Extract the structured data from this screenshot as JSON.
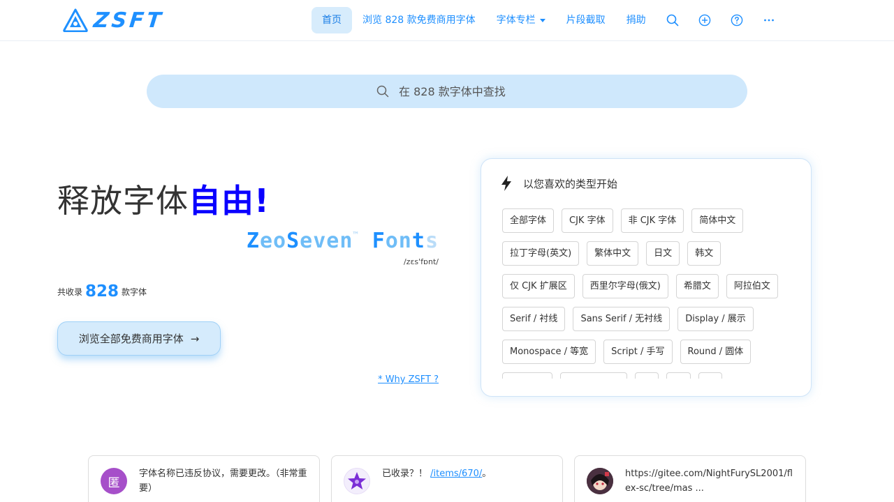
{
  "brand": {
    "name": "ZSFT",
    "color": "#1e90ff"
  },
  "nav": {
    "items": [
      {
        "label": "首页",
        "active": true
      },
      {
        "label": "浏览 828 款免费商用字体"
      },
      {
        "label": "字体专栏"
      },
      {
        "label": "片段截取"
      },
      {
        "label": "捐助"
      }
    ],
    "icons": [
      "search-icon",
      "plus-circle-icon",
      "help-circle-icon",
      "more-icon"
    ]
  },
  "search": {
    "placeholder": "在 828 款字体中查找"
  },
  "hero": {
    "title_plain": "释放字体",
    "title_strong": "自由!",
    "brand_parts": [
      "Z",
      "eo",
      "S",
      "even",
      "™",
      " ",
      "F",
      "on",
      "t",
      "s"
    ],
    "phonetic": "/zεs'fɒnt/",
    "count_prefix": "共收录",
    "count": "828",
    "count_suffix": "款字体",
    "browse_label": "浏览全部免费商用字体",
    "why_link": "* Why ZSFT ?"
  },
  "categories": {
    "heading": "以您喜欢的类型开始",
    "rows": [
      [
        "全部字体",
        "CJK 字体",
        "非 CJK 字体",
        "简体中文"
      ],
      [
        "拉丁字母(英文)",
        "繁体中文",
        "日文",
        "韩文"
      ],
      [
        "仅 CJK 扩展区",
        "西里尔字母(俄文)",
        "希腊文",
        "阿拉伯文"
      ],
      [
        "Serif / 衬线",
        "Sans Serif / 无衬线",
        "Display / 展示"
      ],
      [
        "Monospace / 等宽",
        "Script / 手写",
        "Round / 圆体"
      ],
      [
        "            ",
        "                  ",
        "   ",
        "   ",
        "   "
      ]
    ]
  },
  "messages": [
    {
      "avatar_char": "匿",
      "avatar_color": "#a64fc9",
      "text": "字体名称已违反协议，需要更改。（非常重要）"
    },
    {
      "prefix": "已收录？！",
      "link": "/items/670/",
      "suffix": "。"
    },
    {
      "text": "https://gitee.com/NightFurySL2001/flex-sc/tree/mas ..."
    }
  ]
}
